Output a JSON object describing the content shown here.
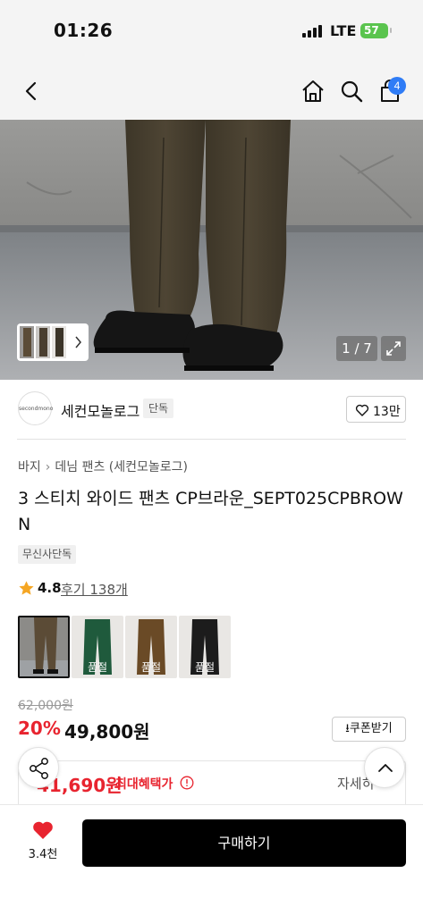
{
  "status": {
    "time": "01:26",
    "network": "LTE",
    "battery": "57"
  },
  "nav": {
    "cart_count": "4"
  },
  "gallery": {
    "counter": "1 / 7"
  },
  "brand": {
    "logo_text": "secondmono",
    "name": "세컨모놀로그",
    "tag": "단독",
    "likes": "13만"
  },
  "breadcrumb": [
    "바지",
    "데님 팬츠 (세컨모놀로그)"
  ],
  "product": {
    "title": "3 스티치 와이드 팬츠 CP브라운_SEPT025CPBROWN",
    "exclusive_tag": "무신사단독",
    "rating": "4.8",
    "reviews": "후기 138개"
  },
  "swatches": [
    {
      "color": "#5b4b36",
      "sold_out": ""
    },
    {
      "color": "#1f5a3c",
      "sold_out": "품절"
    },
    {
      "color": "#6a4a26",
      "sold_out": "품절"
    },
    {
      "color": "#1c1c1c",
      "sold_out": "품절"
    }
  ],
  "price": {
    "original": "62,000원",
    "discount": "20%",
    "sale": "49,800원",
    "coupon_label": "쿠폰받기"
  },
  "benefit": {
    "price": "41,690원",
    "label": "최대혜택가",
    "detail": "자세히"
  },
  "bottom": {
    "wish_count": "3.4천",
    "buy_label": "구매하기"
  },
  "colors": {
    "accent_red": "#e8242f",
    "badge_blue": "#2f7cf6",
    "battery_green": "#5ac44e"
  }
}
